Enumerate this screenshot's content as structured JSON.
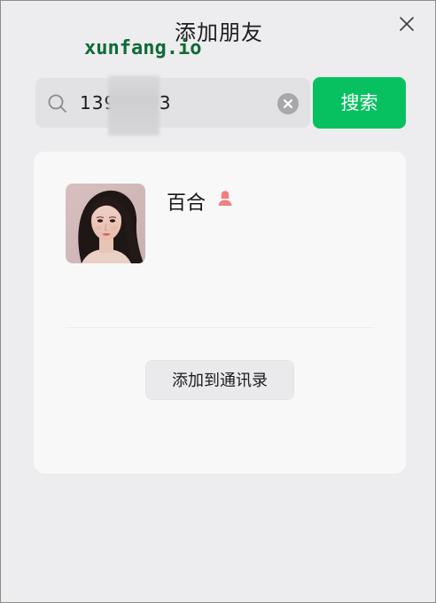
{
  "window": {
    "title": "添加朋友"
  },
  "watermark": {
    "text": "xunfang.io"
  },
  "search": {
    "value": "139    7353",
    "button_label": "搜索"
  },
  "result": {
    "name": "百合",
    "gender": "female",
    "add_button_label": "添加到通讯录"
  },
  "colors": {
    "accent_green": "#07c160",
    "gender_female": "#f08080",
    "watermark_green": "#0f6b36"
  },
  "icons": {
    "close": "close-icon",
    "search": "search-icon",
    "clear": "clear-icon",
    "gender": "female-user-icon"
  }
}
